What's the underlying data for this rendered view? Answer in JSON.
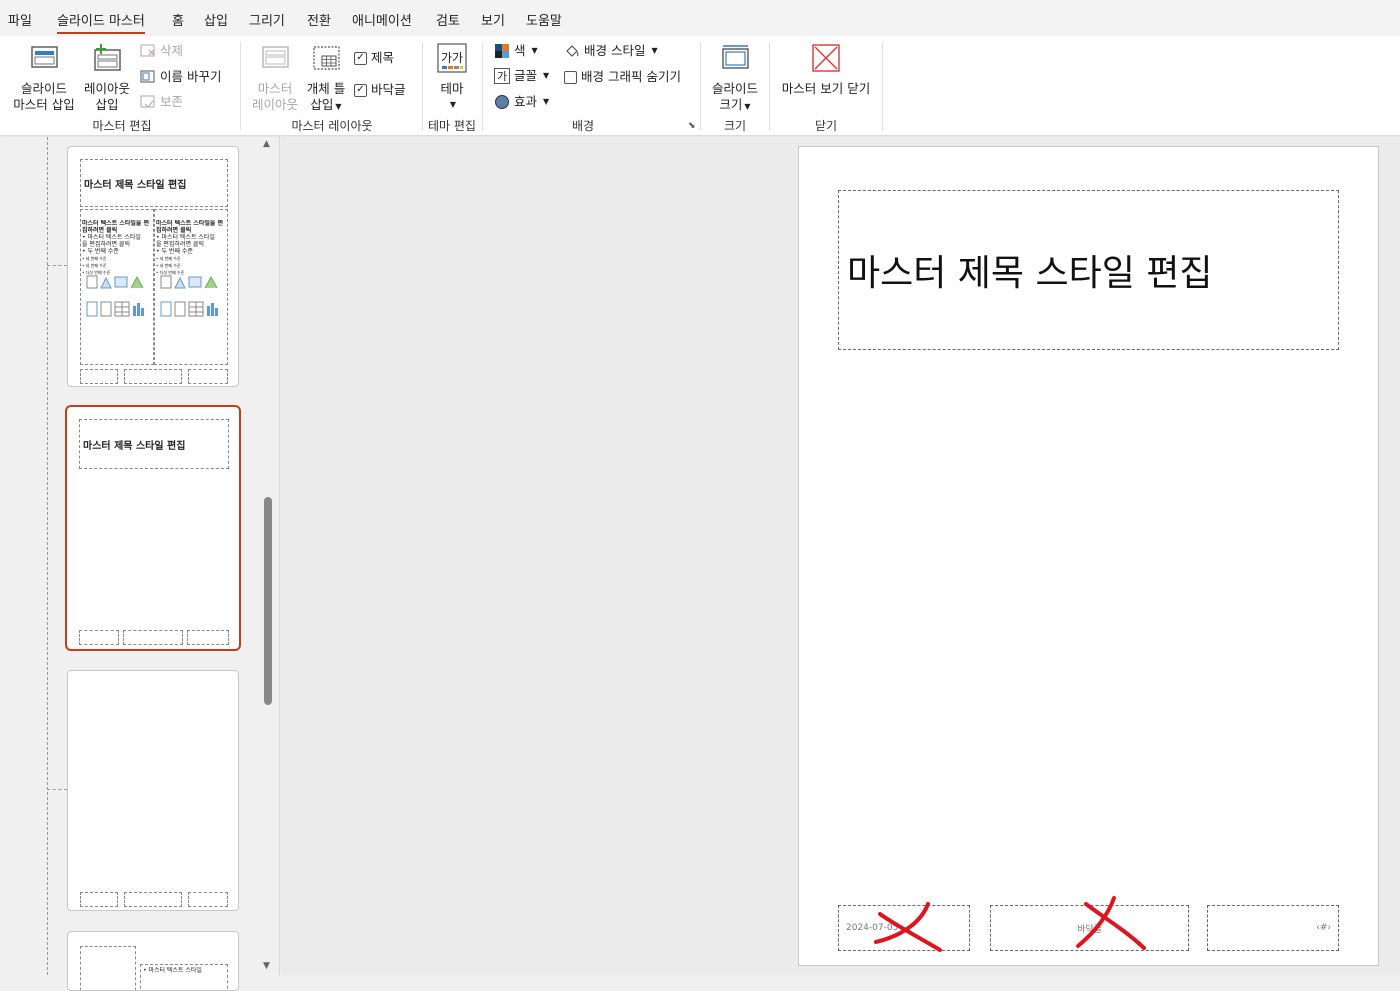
{
  "menu": {
    "tabs": [
      "파일",
      "슬라이드 마스터",
      "홈",
      "삽입",
      "그리기",
      "전환",
      "애니메이션",
      "검토",
      "보기",
      "도움말"
    ],
    "active_index": 1
  },
  "ribbon": {
    "master_edit": {
      "insert_master": "슬라이드 마스터 삽입",
      "insert_master_line1": "슬라이드",
      "insert_master_line2": "마스터 삽입",
      "insert_layout_line1": "레이아웃",
      "insert_layout_line2": "삽입",
      "delete": "삭제",
      "rename": "이름 바꾸기",
      "preserve": "보존",
      "group_label": "마스터 편집"
    },
    "master_layout": {
      "master_layout_line1": "마스터",
      "master_layout_line2": "레이아웃",
      "insert_placeholder_line1": "개체 틀",
      "insert_placeholder_line2": "삽입",
      "title_check": "제목",
      "footer_check": "바닥글",
      "group_label": "마스터 레이아웃"
    },
    "edit_theme": {
      "theme": "테마",
      "theme_icon_text": "가가",
      "group_label": "테마 편집"
    },
    "background": {
      "colors": "색",
      "fonts": "글꼴",
      "fonts_icon_text": "가",
      "effects": "효과",
      "bg_styles": "배경 스타일",
      "hide_bg_graphics": "배경 그래픽 숨기기",
      "group_label": "배경"
    },
    "size": {
      "slide_size_line1": "슬라이드",
      "slide_size_line2": "크기",
      "group_label": "크기"
    },
    "close": {
      "close_master": "마스터 보기 닫기",
      "group_label": "닫기"
    }
  },
  "thumbnails": {
    "t1": {
      "title": "마스터 제목 스타일 편집",
      "col_text": [
        "마스터 텍스트 스타일을 편",
        "집하려면 클릭",
        "• 마스터 텍스트 스타일",
        "  을 편집하려면 클릭",
        "  • 두 번째 수준",
        "    • 세 번째 수준",
        "      • 네 번째 수준",
        "        • 다섯 번째 수준"
      ]
    },
    "t2": {
      "title": "마스터 제목 스타일 편집"
    },
    "t4": {
      "col_text": "• 마스터 텍스트 스타일"
    }
  },
  "slide": {
    "title": "마스터 제목 스타일 편집",
    "date": "2024-07-05",
    "footer": "바닥글",
    "page_number": "‹#›"
  },
  "colors": {
    "accent": "#c43e1c",
    "annotation": "#e0141e"
  }
}
